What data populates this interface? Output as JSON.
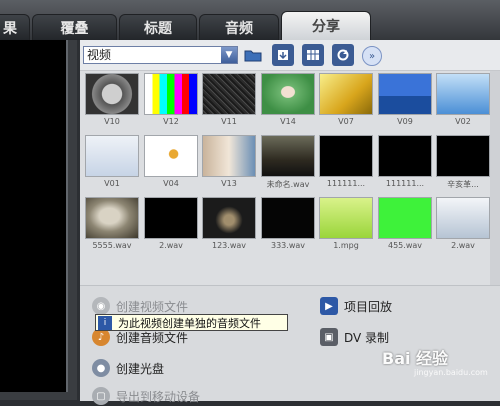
{
  "tabs": [
    {
      "label": "果",
      "active": false
    },
    {
      "label": "覆叠",
      "active": false
    },
    {
      "label": "标题",
      "active": false
    },
    {
      "label": "音频",
      "active": false
    },
    {
      "label": "分享",
      "active": true
    }
  ],
  "toolbar": {
    "selected_type": "视频",
    "icons": [
      "folder-icon",
      "import-icon",
      "view-options-icon",
      "refresh-icon",
      "expand-icon"
    ]
  },
  "gallery": [
    {
      "caption": "V10",
      "thumb": "countdown"
    },
    {
      "caption": "V12",
      "thumb": "testcard"
    },
    {
      "caption": "V11",
      "thumb": "noise"
    },
    {
      "caption": "V14",
      "thumb": "green-portrait"
    },
    {
      "caption": "V07",
      "thumb": "yellow-abstract"
    },
    {
      "caption": "V09",
      "thumb": "blue-sea"
    },
    {
      "caption": "V02",
      "thumb": "blue-sky"
    },
    {
      "caption": "V01",
      "thumb": "computer"
    },
    {
      "caption": "V04",
      "thumb": "flower"
    },
    {
      "caption": "V13",
      "thumb": "laptop-person"
    },
    {
      "caption": "未命名.wav",
      "thumb": "dark-scene"
    },
    {
      "caption": "111111...",
      "thumb": "black"
    },
    {
      "caption": "111111...",
      "thumb": "black"
    },
    {
      "caption": "辛亥革...",
      "thumb": "black"
    },
    {
      "caption": "5555.wav",
      "thumb": "sepia-face"
    },
    {
      "caption": "2.wav",
      "thumb": "black"
    },
    {
      "caption": "123.wav",
      "thumb": "dark-film"
    },
    {
      "caption": "333.wav",
      "thumb": "dark-text"
    },
    {
      "caption": "1.mpg",
      "thumb": "lime-green"
    },
    {
      "caption": "455.wav",
      "thumb": "bright-green"
    },
    {
      "caption": "2.wav",
      "thumb": "snow"
    }
  ],
  "actions": {
    "create_video": "创建视频文件",
    "create_audio": "创建音频文件",
    "create_disc": "创建光盘",
    "export_mobile": "导出到移动设备",
    "project_playback": "项目回放",
    "dv_record": "DV 录制"
  },
  "tooltip": "为此视频创建单独的音频文件",
  "watermark": {
    "main": "Bai 经验",
    "sub": "jingyan.baidu.com"
  }
}
